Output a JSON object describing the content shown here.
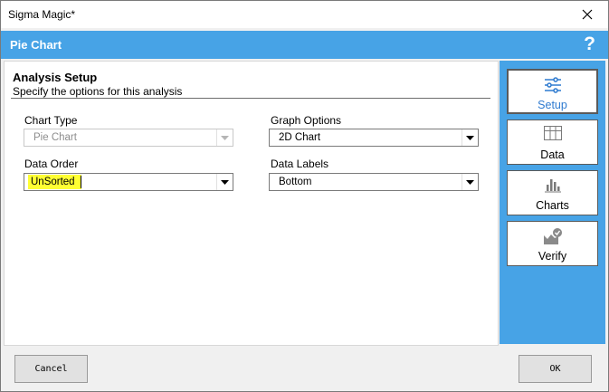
{
  "window": {
    "title": "Sigma Magic*"
  },
  "header": {
    "title": "Pie Chart",
    "help_label": "?"
  },
  "setup": {
    "heading": "Analysis Setup",
    "subheading": "Specify the options for this analysis",
    "chart_type": {
      "label": "Chart Type",
      "value": "Pie Chart",
      "enabled": false
    },
    "graph_options": {
      "label": "Graph Options",
      "value": "2D Chart"
    },
    "data_order": {
      "label": "Data Order",
      "value": "UnSorted"
    },
    "data_labels": {
      "label": "Data Labels",
      "value": "Bottom"
    }
  },
  "sidebar": {
    "items": [
      {
        "label": "Setup",
        "icon": "sliders-icon",
        "active": true
      },
      {
        "label": "Data",
        "icon": "grid-icon",
        "active": false
      },
      {
        "label": "Charts",
        "icon": "bar-chart-icon",
        "active": false
      },
      {
        "label": "Verify",
        "icon": "verify-icon",
        "active": false
      }
    ]
  },
  "footer": {
    "cancel_label": "Cancel",
    "ok_label": "OK"
  },
  "colors": {
    "accent": "#47a3e6",
    "highlight": "#ffff33",
    "active_text": "#2f7bd0"
  }
}
